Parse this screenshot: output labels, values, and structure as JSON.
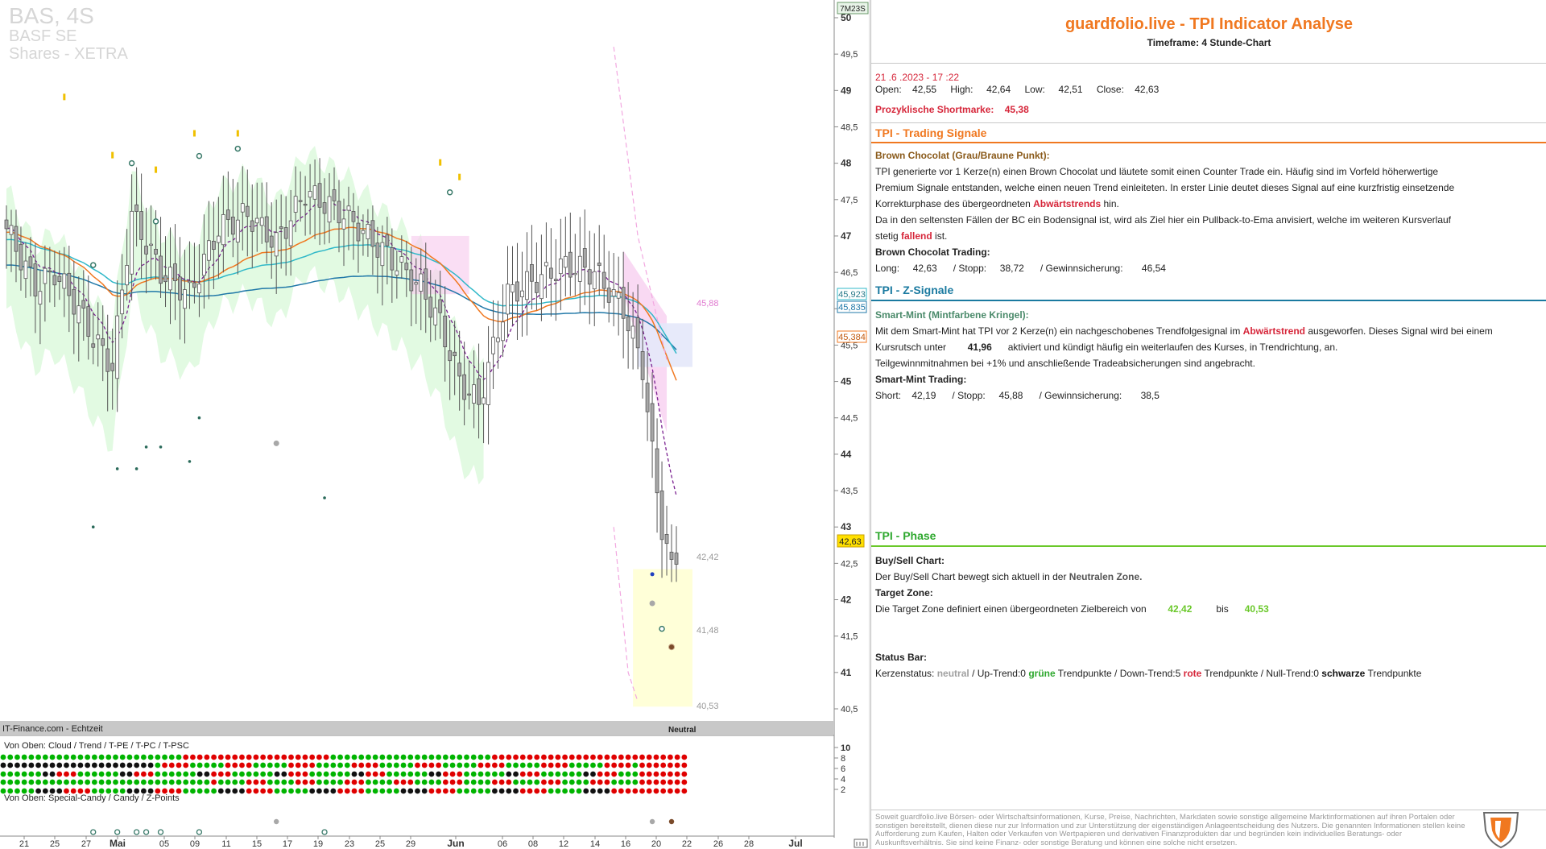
{
  "chart": {
    "symbol": "BAS, 4S",
    "name": "BASF SE",
    "market": "Shares - XETRA",
    "countdown": "7M23S",
    "source_label": "IT-Finance.com - Echtzeit",
    "phase_label": "Neutral",
    "status_bar_title": "Von Oben: Cloud / Trend / T-PE / T-PC / T-PSC",
    "special_bar_title": "Von Oben: Special-Candy / Candy / Z-Points",
    "price_ticks": [
      "50",
      "49,5",
      "49",
      "48,5",
      "48",
      "47,5",
      "47",
      "46,5",
      "46",
      "45,5",
      "45",
      "44,5",
      "44",
      "43,5",
      "43",
      "42,5",
      "42",
      "41,5",
      "41",
      "40,5"
    ],
    "price_labels": {
      "ema_teal": "45,923",
      "ema_blue": "45,835",
      "ema_orange": "45,384",
      "last": "42,63"
    },
    "target_labels": {
      "top_stop": "45,88",
      "target_1": "42,42",
      "target_2": "41,48",
      "target_3": "40,53"
    },
    "x_labels": [
      "21",
      "25",
      "27",
      "Mai",
      "05",
      "09",
      "11",
      "15",
      "17",
      "19",
      "23",
      "25",
      "29",
      "Jun",
      "06",
      "08",
      "12",
      "14",
      "16",
      "20",
      "22",
      "26",
      "28",
      "Jul"
    ],
    "status_ticks": [
      "10",
      "8",
      "6",
      "4",
      "2"
    ],
    "colors": {
      "up": "#00b400",
      "down": "#e00000",
      "neutral": "#111111",
      "ema_orange": "#f07820",
      "ema_teal": "#30b8c8",
      "ema_blue": "#2078a8",
      "trend_purple": "#7a2090",
      "cloud_green": "#d8f8d8",
      "cloud_pink": "#f8d0f0",
      "target_zone": "#ffffd8"
    }
  },
  "panel": {
    "title": "guardfolio.live - TPI Indicator Analyse",
    "subtitle": "Timeframe: 4 Stunde-Chart",
    "datetime": "21 .6 .2023  - 17 :22",
    "ohlc": {
      "open_label": "Open:",
      "open": "42,55",
      "high_label": "High:",
      "high": "42,64",
      "low_label": "Low:",
      "low": "42,51",
      "close_label": "Close:",
      "close": "42,63"
    },
    "shortmarke_label": "Prozyklische Shortmarke:",
    "shortmarke_value": "45,38",
    "trading": {
      "title": "TPI - Trading Signale",
      "heading": "Brown Chocolat (Grau/Braune Punkt):",
      "l1": "TPI generierte vor 1  Kerze(n) einen Brown Chocolat und läutete somit einen Counter Trade ein. Häufig sind im Vorfeld höherwertige",
      "l2": "Premium Signale entstanden, welche einen neuen Trend einleiteten. In erster Linie deutet dieses Signal auf eine kurzfristig einsetzende",
      "l3a": "Korrekturphase des übergeordneten ",
      "l3b": "Abwärtstrends",
      "l3c": " hin.",
      "l4": "Da in den seltensten Fällen der BC ein Bodensignal ist, wird als Ziel hier ein Pullback-to-Ema anvisiert, welche im weiteren Kursverlauf",
      "l5a": "stetig ",
      "l5b": "fallend",
      "l5c": "  ist.",
      "trade_heading": "Brown Chocolat Trading:",
      "pos_label": "Long:",
      "pos_value": "42,63",
      "stop_label": "/ Stopp:",
      "stop_value": "38,72",
      "gain_label": "/ Gewinnsicherung:",
      "gain_value": "46,54"
    },
    "z": {
      "title": "TPI - Z-Signale",
      "heading": "Smart-Mint (Mintfarbene Kringel):",
      "l1a": "Mit dem Smart-Mint hat TPI vor 2  Kerze(n) ein nachgeschobenes Trendfolgesignal im ",
      "l1b": "Abwärtstrend",
      "l1c": "  ausgeworfen. Dieses Signal wird bei einem",
      "l2a": "Kursrutsch unter ",
      "l2b": "41,96",
      "l2c": "  aktiviert und kündigt häufig ein weiterlaufen des Kurses, in Trendrichtung, an.",
      "l3": "Teilgewinnmitnahmen bei +1% und anschließende Tradeabsicherungen sind angebracht.",
      "trade_heading": "Smart-Mint Trading:",
      "pos_label": "Short:",
      "pos_value": "42,19",
      "stop_label": "/ Stopp:",
      "stop_value": "45,88",
      "gain_label": "/ Gewinnsicherung:",
      "gain_value": "38,5"
    },
    "phase": {
      "title": "TPI - Phase",
      "bs_heading": "Buy/Sell Chart:",
      "bs_a": "Der Buy/Sell Chart bewegt sich aktuell in der ",
      "bs_b": "Neutralen Zone.",
      "tz_heading": "Target Zone:",
      "tz_a": "Die Target Zone definiert einen übergeordneten Zielbereich von",
      "tz_v1": "42,42",
      "tz_bis": "bis",
      "tz_v2": "40,53",
      "sb_heading": "Status Bar:",
      "sb_1": "Kerzenstatus:",
      "sb_2": "neutral",
      "sb_3": "  / Up-Trend:0 ",
      "sb_4": "grüne",
      "sb_5": " Trendpunkte  / Down-Trend:5 ",
      "sb_6": "rote",
      "sb_7": " Trendpunkte / Null-Trend:0 ",
      "sb_8": "schwarze",
      "sb_9": " Trendpunkte"
    },
    "disclaimer": "Soweit guardfolio.live Börsen- oder Wirtschaftsinformationen, Kurse, Preise, Nachrichten, Markdaten sowie sonstige allgemeine Marktinformationen auf ihren Portalen oder sonstigen bereitstellt, dienen diese nur zur Information und zur Unterstützung der eigenständigen Anlageentscheidung des Nutzers. Die genannten Informationen stellen keine Aufforderung zum Kaufen, Halten oder Verkaufen von Wertpapieren und derivativen Finanzprodukten dar und begründen kein individuelles Beratungs- oder Auskunftsverhältnis. Sie sind keine Finanz- oder sonstige Beratung und können eine solche nicht ersetzen."
  }
}
